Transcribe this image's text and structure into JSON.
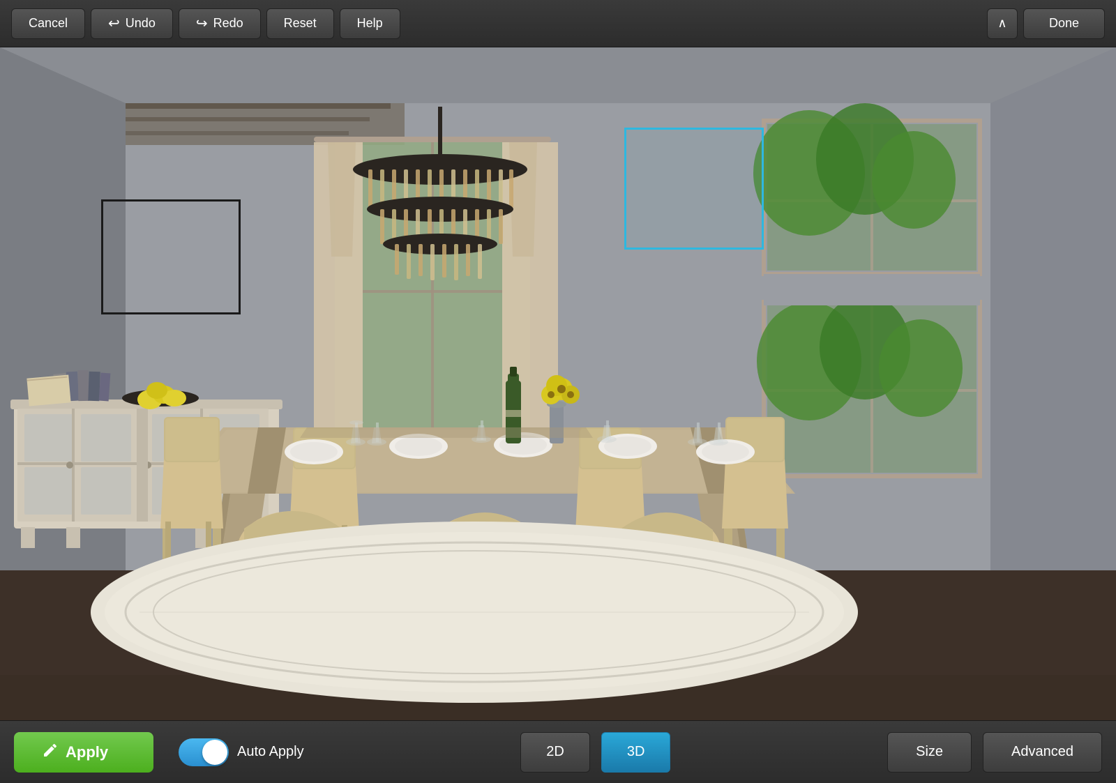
{
  "toolbar": {
    "cancel_label": "Cancel",
    "undo_label": "Undo",
    "redo_label": "Redo",
    "reset_label": "Reset",
    "help_label": "Help",
    "done_label": "Done",
    "chevron_up": "⌃"
  },
  "bottom_bar": {
    "apply_label": "Apply",
    "auto_apply_label": "Auto Apply",
    "view_2d_label": "2D",
    "view_3d_label": "3D",
    "size_label": "Size",
    "advanced_label": "Advanced",
    "toggle_active": true,
    "active_view": "3D"
  },
  "icons": {
    "undo_icon": "↩",
    "redo_icon": "↪",
    "apply_icon": "✏",
    "chevron_up": "∧"
  },
  "colors": {
    "apply_green": "#5cb82e",
    "toggle_blue": "#3aabdc",
    "active_view_blue": "#1e90c8",
    "selection_blue": "#2eb8e0"
  }
}
